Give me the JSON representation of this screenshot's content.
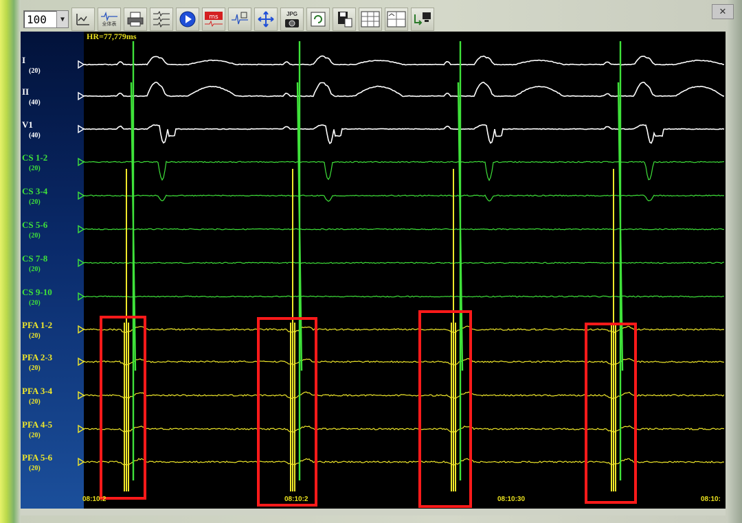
{
  "toolbar": {
    "zoom_value": "100",
    "icons": [
      "baseline-icon",
      "full-view-icon",
      "print-icon",
      "channels-icon",
      "play-icon",
      "ms-scale-icon",
      "caliper-icon",
      "move-icon",
      "jpg-export-icon",
      "refresh-icon",
      "save-icon",
      "grid-icon",
      "layout-icon",
      "monitor-icon"
    ],
    "full_view_label": "全体表",
    "jpg_label": "JPG"
  },
  "hr_readout": "HR=77,779ms",
  "channels": [
    {
      "name": "I",
      "gain": "(20)",
      "color": "#ffffff"
    },
    {
      "name": "II",
      "gain": "(40)",
      "color": "#ffffff"
    },
    {
      "name": "V1",
      "gain": "(40)",
      "color": "#ffffff"
    },
    {
      "name": "CS 1-2",
      "gain": "(20)",
      "color": "#3fe23a"
    },
    {
      "name": "CS 3-4",
      "gain": "(20)",
      "color": "#3fe23a"
    },
    {
      "name": "CS 5-6",
      "gain": "(20)",
      "color": "#3fe23a"
    },
    {
      "name": "CS 7-8",
      "gain": "(20)",
      "color": "#3fe23a"
    },
    {
      "name": "CS 9-10",
      "gain": "(20)",
      "color": "#3fe23a"
    },
    {
      "name": "PFA 1-2",
      "gain": "(20)",
      "color": "#f0e82a"
    },
    {
      "name": "PFA 2-3",
      "gain": "(20)",
      "color": "#f0e82a"
    },
    {
      "name": "PFA 3-4",
      "gain": "(20)",
      "color": "#f0e82a"
    },
    {
      "name": "PFA 4-5",
      "gain": "(20)",
      "color": "#f0e82a"
    },
    {
      "name": "PFA 5-6",
      "gain": "(20)",
      "color": "#f0e82a"
    }
  ],
  "time_labels": [
    "08:10:2",
    "08:10:2",
    "08:10:30",
    "08:10:"
  ],
  "colors": {
    "surface": "#ffffff",
    "cs": "#3fe23a",
    "pfa": "#f0e82a",
    "highlight": "#ff1a1a",
    "label_text": "#e9e01e"
  }
}
